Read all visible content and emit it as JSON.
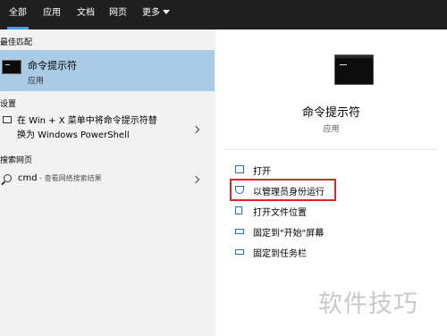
{
  "tabs": [
    {
      "label": "全部",
      "active": true
    },
    {
      "label": "应用",
      "active": false
    },
    {
      "label": "文档",
      "active": false
    },
    {
      "label": "网页",
      "active": false
    },
    {
      "label": "更多",
      "active": false
    }
  ],
  "left": {
    "best_match_title": "最佳匹配",
    "best_match": {
      "name": "命令提示符",
      "type": "应用",
      "icon": "cmd-icon"
    },
    "settings_title": "设置",
    "setting": {
      "line1": "在 Win + X 菜单中将命令提示符替",
      "line2": "换为 Windows PowerShell",
      "icon": "monitor-icon"
    },
    "web_title": "搜索网页",
    "web_search": {
      "query": "cmd",
      "hint": " - 查看网络搜索结果",
      "icon": "search-icon"
    }
  },
  "right": {
    "app_name": "命令提示符",
    "app_type": "应用",
    "actions": [
      {
        "label": "打开",
        "icon": "open-icon"
      },
      {
        "label": "以管理员身份运行",
        "icon": "admin-shield-icon",
        "highlighted": true
      },
      {
        "label": "打开文件位置",
        "icon": "file-location-icon"
      },
      {
        "label": "固定到\"开始\"屏幕",
        "icon": "pin-icon"
      },
      {
        "label": "固定到任务栏",
        "icon": "pin-icon"
      }
    ]
  },
  "colors": {
    "topbar": "#1f1f1f",
    "selection": "#aacbe5",
    "highlight_border": "#d92626",
    "accent": "#4a9be8"
  },
  "watermark": "软件技巧"
}
